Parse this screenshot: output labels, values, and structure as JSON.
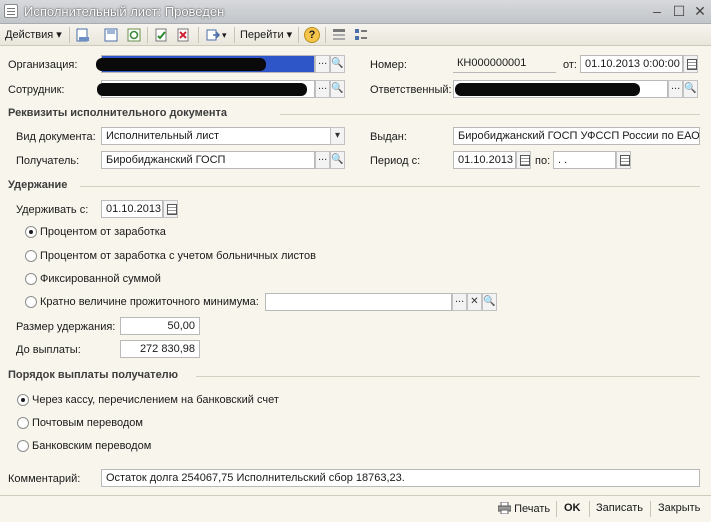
{
  "window": {
    "title": "Исполнительный лист: Проведен"
  },
  "toolbar": {
    "actions_label": "Действия",
    "goto_label": "Перейти",
    "help_label": "?"
  },
  "header": {
    "org_label": "Организация:",
    "emp_label": "Сотрудник:",
    "num_label": "Номер:",
    "num_value": "КН000000001",
    "date_label": "от:",
    "date_value": "01.10.2013  0:00:00",
    "resp_label": "Ответственный:"
  },
  "doc_section": {
    "title": "Реквизиты исполнительного документа",
    "type_label": "Вид документа:",
    "type_value": "Исполнительный лист",
    "issued_label": "Выдан:",
    "issued_value": "Биробиджанский ГОСП УФССП России по ЕАО",
    "recipient_label": "Получатель:",
    "recipient_value": "Биробиджанский ГОСП",
    "period_label": "Период с:",
    "period_from": "01.10.2013",
    "period_to_label": "по:",
    "period_to": " .  .    "
  },
  "withhold": {
    "title": "Удержание",
    "from_label": "Удерживать с:",
    "from_value": "01.10.2013",
    "options": [
      "Процентом от заработка",
      "Процентом от заработка с учетом больничных листов",
      "Фиксированной суммой",
      "Кратно величине прожиточного минимума:"
    ],
    "selected": 0,
    "size_label": "Размер удержания:",
    "size_value": "50,00",
    "topay_label": "До выплаты:",
    "topay_value": "272 830,98"
  },
  "payout": {
    "title": "Порядок выплаты получателю",
    "options": [
      "Через кассу, перечислением на банковский счет",
      "Почтовым переводом",
      "Банковским переводом"
    ],
    "selected": 0
  },
  "comment": {
    "label": "Комментарий:",
    "value": "Остаток долга 254067,75  Исполнительский сбор 18763,23."
  },
  "footer": {
    "print_label": "Печать",
    "ok_label": "OK",
    "save_label": "Записать",
    "close_label": "Закрыть"
  }
}
